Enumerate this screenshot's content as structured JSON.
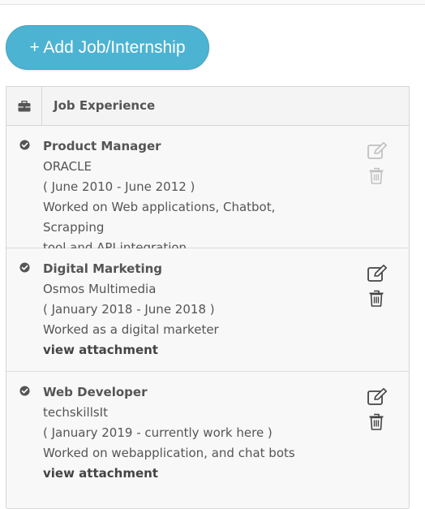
{
  "toolbar": {
    "add_label": "+ Add Job/Internship"
  },
  "panel": {
    "header_title": "Job Experience",
    "header_icon": "briefcase-icon"
  },
  "entries": [
    {
      "title": "Product Manager",
      "company": "ORACLE",
      "period": "( June 2010 - June 2012 )",
      "description_line1": "Worked on Web applications, Chatbot, Scrapping",
      "description_line2": "tool and API integration",
      "attachment": "",
      "actions_enabled": false
    },
    {
      "title": "Digital Marketing",
      "company": "Osmos Multimedia",
      "period": "( January 2018 - June 2018 )",
      "description_line1": "Worked as a digital marketer",
      "description_line2": "",
      "attachment": "view attachment",
      "actions_enabled": true
    },
    {
      "title": "Web Developer",
      "company": "techskillsIt",
      "period": "( January 2019 - currently work here )",
      "description_line1": "Worked on webapplication, and chat bots",
      "description_line2": "",
      "attachment": "view attachment",
      "actions_enabled": true
    }
  ],
  "colors": {
    "accent": "#4db3d2",
    "text": "#555555",
    "icon_active": "#444444",
    "icon_disabled": "#bbbbbb"
  }
}
